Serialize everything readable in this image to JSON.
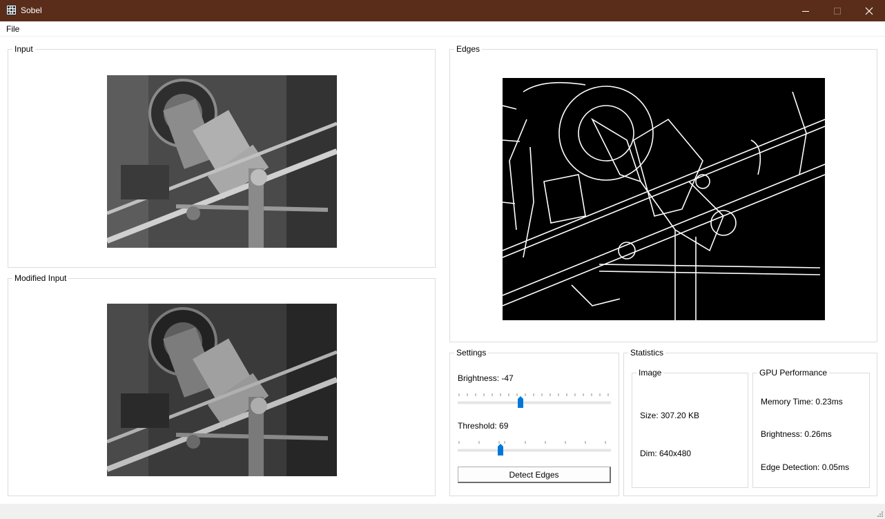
{
  "window": {
    "title": "Sobel"
  },
  "menu": {
    "file_label": "File"
  },
  "panels": {
    "input_title": "Input",
    "modified_title": "Modified Input",
    "edges_title": "Edges",
    "settings_title": "Settings",
    "statistics_title": "Statistics"
  },
  "settings": {
    "brightness_label": "Brightness: -47",
    "brightness_value": -47,
    "threshold_label": "Threshold: 69",
    "threshold_value": 69,
    "detect_button": "Detect Edges"
  },
  "statistics": {
    "image_title": "Image",
    "size_text": "Size: 307.20 KB",
    "dim_text": "Dim: 640x480",
    "gpu_title": "GPU Performance",
    "memory_time_text": "Memory Time: 0.23ms",
    "brightness_time_text": "Brightness: 0.26ms",
    "edge_time_text": "Edge Detection: 0.05ms"
  },
  "colors": {
    "titlebar": "#5a2d1a",
    "slider_thumb": "#0078d7",
    "statusbar": "#f0f0f0"
  }
}
